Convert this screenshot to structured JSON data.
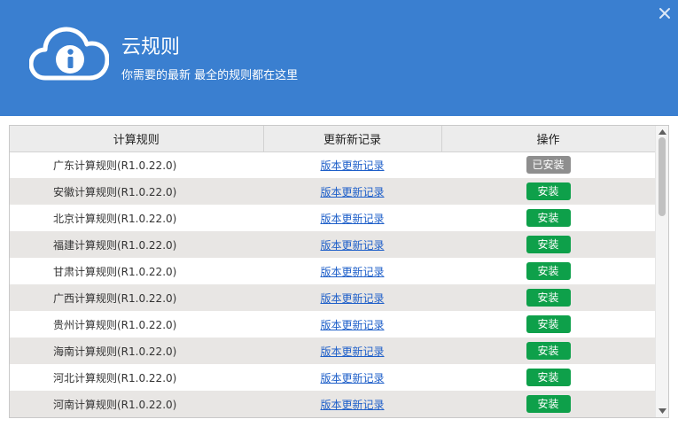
{
  "window": {
    "title": "云规则",
    "subtitle": "你需要的最新 最全的规则都在这里",
    "header_color": "#3a7fd0",
    "logo_icon": "cloud-info-icon",
    "close_icon": "close-icon"
  },
  "table": {
    "columns": [
      "计算规则",
      "更新新记录",
      "操作"
    ],
    "rows": [
      {
        "name": "广东计算规则(R1.0.22.0)",
        "log": "版本更新记录",
        "action": "已安装",
        "installed": true
      },
      {
        "name": "安徽计算规则(R1.0.22.0)",
        "log": "版本更新记录",
        "action": "安装",
        "installed": false
      },
      {
        "name": "北京计算规则(R1.0.22.0)",
        "log": "版本更新记录",
        "action": "安装",
        "installed": false
      },
      {
        "name": "福建计算规则(R1.0.22.0)",
        "log": "版本更新记录",
        "action": "安装",
        "installed": false
      },
      {
        "name": "甘肃计算规则(R1.0.22.0)",
        "log": "版本更新记录",
        "action": "安装",
        "installed": false
      },
      {
        "name": "广西计算规则(R1.0.22.0)",
        "log": "版本更新记录",
        "action": "安装",
        "installed": false
      },
      {
        "name": "贵州计算规则(R1.0.22.0)",
        "log": "版本更新记录",
        "action": "安装",
        "installed": false
      },
      {
        "name": "海南计算规则(R1.0.22.0)",
        "log": "版本更新记录",
        "action": "安装",
        "installed": false
      },
      {
        "name": "河北计算规则(R1.0.22.0)",
        "log": "版本更新记录",
        "action": "安装",
        "installed": false
      },
      {
        "name": "河南计算规则(R1.0.22.0)",
        "log": "版本更新记录",
        "action": "安装",
        "installed": false
      }
    ]
  },
  "colors": {
    "install_button": "#0ea04a",
    "installed_button": "#8e8e8e",
    "link": "#1e5fc9"
  }
}
